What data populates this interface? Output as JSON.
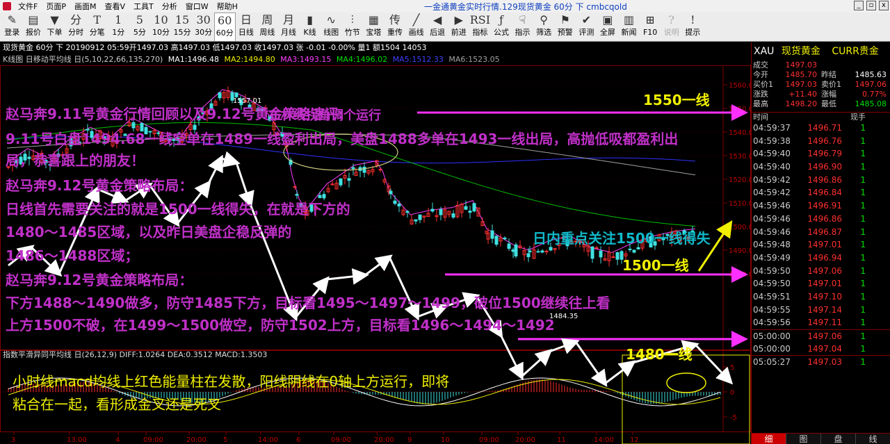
{
  "menu": [
    "文件F",
    "页面P",
    "画面M",
    "查看V",
    "工具T",
    "分析",
    "窗口W",
    "帮助H"
  ],
  "window_title": "一金通黄金实时行情.129现货黄金 60分 下 cmbcqold",
  "window_buttons": [
    "_",
    "▫",
    "x"
  ],
  "toolbar": [
    {
      "icon": "✎",
      "label": "登录"
    },
    {
      "icon": "▤",
      "label": "报价"
    },
    {
      "icon": "▼",
      "label": "下单"
    },
    {
      "icon": "分",
      "label": "分时"
    },
    {
      "icon": "T",
      "label": "分笔"
    },
    {
      "icon": "1",
      "label": "1分"
    },
    {
      "icon": "5",
      "label": "5分"
    },
    {
      "icon": "10",
      "label": "10分"
    },
    {
      "icon": "15",
      "label": "15分"
    },
    {
      "icon": "30",
      "label": "30分"
    },
    {
      "icon": "60",
      "label": "60分",
      "active": true
    },
    {
      "icon": "日",
      "label": "日线"
    },
    {
      "icon": "周",
      "label": "周线"
    },
    {
      "icon": "月",
      "label": "月线"
    },
    {
      "icon": "▮",
      "label": "K线"
    },
    {
      "icon": "∿",
      "label": "线图"
    },
    {
      "icon": "⫶",
      "label": "竹节"
    },
    {
      "icon": "▦",
      "label": "宝塔"
    },
    {
      "icon": "传",
      "label": "重传"
    },
    {
      "icon": "╱",
      "label": "画线"
    },
    {
      "icon": "◀",
      "label": "后退"
    },
    {
      "icon": "▶",
      "label": "前进"
    },
    {
      "icon": "RSI",
      "label": "指标"
    },
    {
      "icon": "ƒ",
      "label": "公式"
    },
    {
      "icon": "☟",
      "label": "指示"
    },
    {
      "icon": "⚲",
      "label": "筛选"
    },
    {
      "icon": "⚑",
      "label": "预警"
    },
    {
      "icon": "✔",
      "label": "评测"
    },
    {
      "icon": "▣",
      "label": "全屏"
    },
    {
      "icon": "▥",
      "label": "新闻"
    },
    {
      "icon": "⊞",
      "label": "F10"
    },
    {
      "icon": "?",
      "label": "说明",
      "disabled": true
    },
    {
      "icon": "!",
      "label": "提示"
    }
  ],
  "infobar": {
    "text": "现货黄金 60分 下 20190912 05:59开1497.03 高1497.03 低1497.03 收1497.03 张 -0.01 -0.00% 量1 额1504 14053"
  },
  "mabar": {
    "prefix": "K线图 日移动平均线 日(5,10,22,66,135,270)",
    "ma1": "MA1:1496.48",
    "ma2": "MA2:1494.80",
    "ma3": "MA3:1493.15",
    "ma4": "MA4:1496.02",
    "ma5": "MA5:1512.33",
    "ma6": "MA6:1523.05",
    "colors": {
      "ma1": "#ffffff",
      "ma2": "#f0f000",
      "ma3": "#ff40ff",
      "ma4": "#00e000",
      "ma5": "#3030ff",
      "ma6": "#a0a0a0"
    }
  },
  "price_axis": [
    "1560.00",
    "1550.00",
    "1540.00",
    "1530.00",
    "1520.00",
    "1510.00",
    "1500.00",
    "1490.00",
    "1480.00"
  ],
  "macd_axis": [
    "5",
    "0",
    "-5"
  ],
  "macd_header": "指数平滑异同平均线 日(26,12,9) DIFF:1.0264 DEA:0.3512 MACD:1.3503",
  "time_axis": [
    "3",
    "13:00",
    "4",
    "09:00",
    "20:00",
    "5",
    "14:00",
    "6",
    "09:00",
    "20:00",
    "9",
    "10",
    "09:00",
    "20:00",
    "11",
    "14:00",
    "12"
  ],
  "chart_labels": {
    "high": "1557.01",
    "low": "1484.35"
  },
  "annotations": {
    "line1550": "1550一线",
    "line1500": "1500一线",
    "line1480": "1480一线",
    "focus": "日内重点关注1500一线得失",
    "text1": "赵马奔9.11号黄金行情回顾以及9.12号黄金策略速评:",
    "text_overlap": "布林线拐角调个运行",
    "text2": "9.11号白盘1494.68一线空单在1489一线盈利出局，美盘1488多单在1493一线出局，高抛低吸都盈利出",
    "text3": "局，恭喜跟上的朋友！",
    "text4": "赵马奔9.12号黄金策略布局：",
    "text5": "日线首先需要关注的就是1500一线得失，在就是下方的",
    "text6": "1480～1485区域，以及昨日美盘企稳反弹的",
    "text7": "1486～1488区域；",
    "text8": "赵马奔9.12号黄金策略布局：",
    "text9": "下方1488～1490做多，防守1485下方，目标看1495～1497～1499，破位1500继续往上看",
    "text10": "上方1500不破，在1499～1500做空，防守1502上方，目标看1496～1494～1492",
    "macd1": "小时线macd均线上红色能量柱在发散，阳线阴线在0轴上方运行，即将",
    "macd2": "粘合在一起，看形成金叉还是死叉"
  },
  "right_panel": {
    "code": "XAU",
    "name": "现货黄金",
    "cname": "CURR贵金",
    "quote": [
      {
        "l1": "成交",
        "v1": "1497.03",
        "l2": "",
        "v2": ""
      },
      {
        "l1": "今开",
        "v1": "1485.70",
        "l2": "昨结",
        "v2": "1485.63"
      },
      {
        "l1": "买价1",
        "v1": "1497.03",
        "l2": "卖价1",
        "v2": "1497.06"
      },
      {
        "l1": "涨跌",
        "v1": "+11.40",
        "l2": "涨幅",
        "v2": "0.77%"
      },
      {
        "l1": "最高",
        "v1": "1498.20",
        "l2": "最低",
        "v2": "1485.08"
      }
    ],
    "tick_header": [
      "时间",
      "",
      "现手"
    ],
    "ticks": [
      {
        "t": "04:59:37",
        "p": "1496.71",
        "v": "1"
      },
      {
        "t": "04:59:38",
        "p": "1496.76",
        "v": "1"
      },
      {
        "t": "04:59:40",
        "p": "1496.79",
        "v": "1"
      },
      {
        "t": "04:59:40",
        "p": "1496.90",
        "v": "1"
      },
      {
        "t": "04:59:42",
        "p": "1496.86",
        "v": "1"
      },
      {
        "t": "04:59:42",
        "p": "1496.84",
        "v": "1"
      },
      {
        "t": "04:59:46",
        "p": "1496.91",
        "v": "1"
      },
      {
        "t": "04:59:46",
        "p": "1496.86",
        "v": "1"
      },
      {
        "t": "04:59:46",
        "p": "1496.87",
        "v": "1"
      },
      {
        "t": "04:59:48",
        "p": "1497.01",
        "v": "1"
      },
      {
        "t": "04:59:49",
        "p": "1496.94",
        "v": "1"
      },
      {
        "t": "04:59:50",
        "p": "1497.06",
        "v": "1"
      },
      {
        "t": "04:59:50",
        "p": "1497.01",
        "v": "1"
      },
      {
        "t": "04:59:51",
        "p": "1497.10",
        "v": "1"
      },
      {
        "t": "04:59:55",
        "p": "1497.14",
        "v": "1"
      },
      {
        "t": "04:59:56",
        "p": "1497.11",
        "v": "1"
      },
      {
        "t": "05:00:00",
        "p": "1497.06",
        "v": "1"
      },
      {
        "t": "05:00:00",
        "p": "1497.04",
        "v": "1"
      },
      {
        "t": "05:05:27",
        "p": "1497.03",
        "v": "1"
      }
    ],
    "tabs": [
      "细",
      "图",
      "盘",
      "线"
    ]
  }
}
